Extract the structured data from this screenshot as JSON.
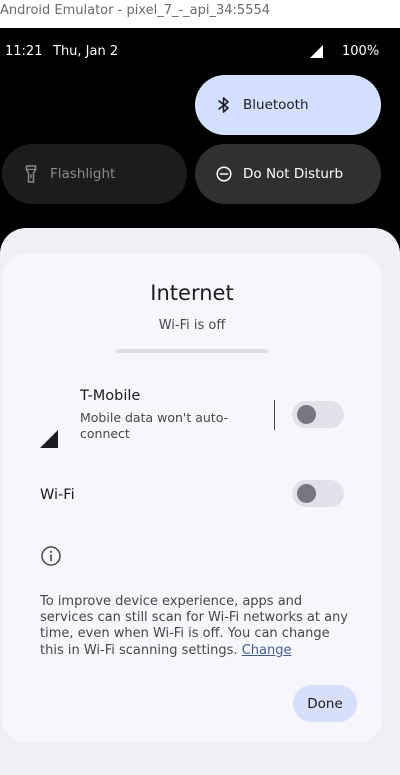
{
  "window": {
    "title": "Android Emulator - pixel_7_-_api_34:5554"
  },
  "statusbar": {
    "time": "11:21",
    "date": "Thu, Jan 2",
    "battery": "100%"
  },
  "quick_settings": {
    "tiles": [
      {
        "label": "Bluetooth",
        "icon": "bluetooth-icon",
        "state": "on"
      },
      {
        "label": "Flashlight",
        "icon": "flashlight-icon",
        "state": "unavailable"
      },
      {
        "label": "Do Not Disturb",
        "icon": "do-not-disturb-icon",
        "state": "off"
      }
    ]
  },
  "dialog": {
    "title": "Internet",
    "subtitle": "Wi-Fi is off",
    "mobile": {
      "name": "T-Mobile",
      "description": "Mobile data won't auto-connect",
      "enabled": false
    },
    "wifi": {
      "label": "Wi-Fi",
      "enabled": false
    },
    "info": {
      "text": "To improve device experience, apps and services can still scan for Wi-Fi networks at any time, even when Wi-Fi is off. You can change this in Wi-Fi scanning settings. ",
      "link": "Change"
    },
    "done_label": "Done"
  },
  "colors": {
    "bluetooth_tile": "#d3e0ff",
    "dialog_bg": "#f7f6fc",
    "done_button": "#d6e0fa",
    "link": "#445e91"
  }
}
